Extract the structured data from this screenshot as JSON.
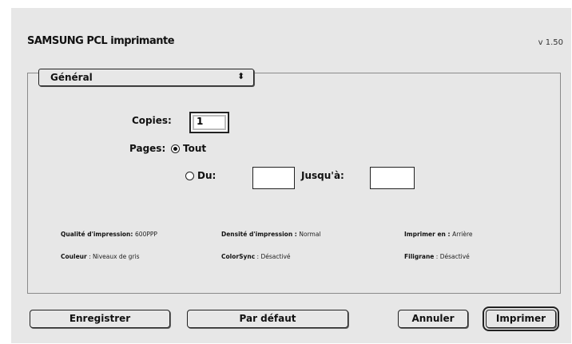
{
  "window": {
    "title": "SAMSUNG PCL imprimante",
    "version": "v 1.50"
  },
  "panel_selector": {
    "selected": "Général"
  },
  "form": {
    "copies_label": "Copies:",
    "copies_value": "1",
    "pages_label": "Pages:",
    "all_label": "Tout",
    "from_label": "Du:",
    "to_label": "Jusqu'à:",
    "from_value": "",
    "to_value": "",
    "selected_range": "all"
  },
  "summary": {
    "quality_label": "Qualité d'impression",
    "quality_value": "600PPP",
    "density_label": "Densité d'impression",
    "density_value": "Normal",
    "output_label": "Imprimer en",
    "output_value": "Arrière",
    "color_label": "Couleur",
    "color_value": "Niveaux de gris",
    "colorsync_label": "ColorSync",
    "colorsync_value": "Désactivé",
    "watermark_label": "Filigrane",
    "watermark_value": "Désactivé"
  },
  "buttons": {
    "save": "Enregistrer",
    "defaults": "Par défaut",
    "cancel": "Annuler",
    "print": "Imprimer"
  }
}
